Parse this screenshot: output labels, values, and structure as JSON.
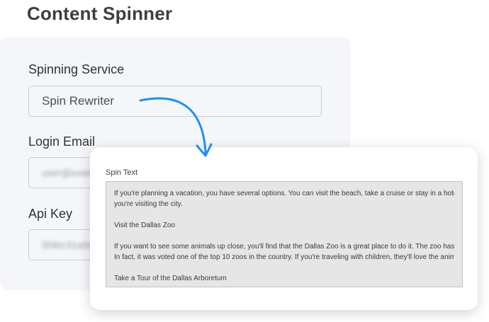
{
  "page": {
    "title": "Content Spinner"
  },
  "settings": {
    "spinning_service_label": "Spinning Service",
    "spinning_service_value": "Spin Rewriter",
    "login_email_label": "Login Email",
    "login_email_value": "user@example.com",
    "api_key_label": "Api Key",
    "api_key_value": "5f4bc31a9d72e"
  },
  "spin_panel": {
    "label": "Spin Text",
    "lines": [
      "If you're planning a vacation, you have several options. You can visit the beach, take a cruise or stay in a hotel.",
      "you're visiting the city.",
      "",
      "Visit the Dallas Zoo",
      "",
      "If you want to see some animals up close, you'll find that the Dallas Zoo is a great place to do it. The zoo has",
      "In fact, it was voted one of the top 10 zoos in the country. If you're traveling with children, they'll love the animal",
      "",
      "Take a Tour of the Dallas Arboretum"
    ]
  },
  "colors": {
    "arrow": "#1e8ff0",
    "card_bg": "#f4f6f9",
    "text_area_bg": "#e6e6e6"
  }
}
